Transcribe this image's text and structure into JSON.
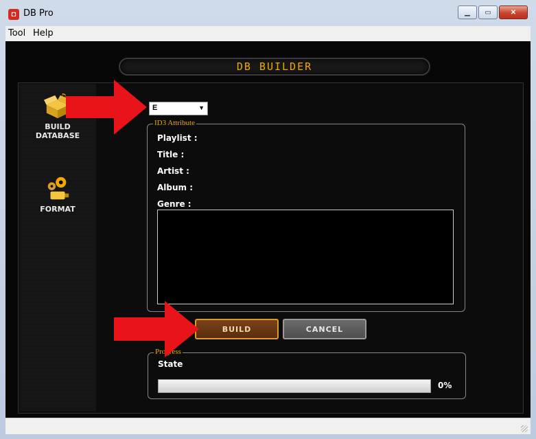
{
  "window": {
    "title": "DB Pro"
  },
  "menu": {
    "items": [
      "Tool",
      "Help"
    ]
  },
  "banner": {
    "title": "DB BUILDER"
  },
  "sidebar": {
    "items": [
      {
        "label_line1": "BUILD",
        "label_line2": "DATABASE",
        "icon": "music-box-icon"
      },
      {
        "label_line1": "FORMAT",
        "label_line2": "",
        "icon": "gear-usb-icon"
      }
    ]
  },
  "drive_select": {
    "value": "E"
  },
  "id3": {
    "legend": "ID3 Attribute",
    "fields": [
      "Playlist :",
      "Title :",
      "Artist :",
      "Album :",
      "Genre :"
    ]
  },
  "buttons": {
    "build": "BUILD",
    "cancel": "CANCEL"
  },
  "progress": {
    "legend": "Progress",
    "state_label": "State",
    "value": 0,
    "text": "0%"
  },
  "colors": {
    "accent": "#f0a800",
    "arrow": "#e8141a"
  }
}
